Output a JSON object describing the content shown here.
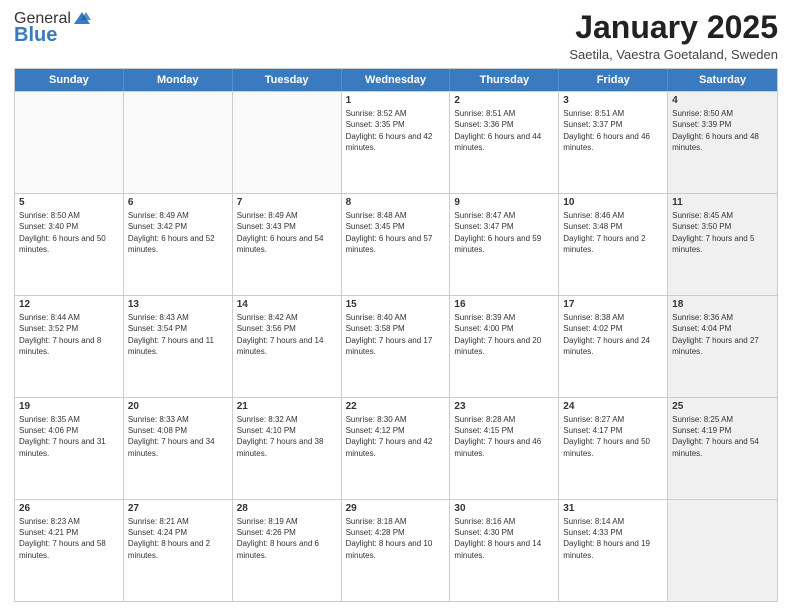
{
  "header": {
    "logo_general": "General",
    "logo_blue": "Blue",
    "month_title": "January 2025",
    "location": "Saetila, Vaestra Goetaland, Sweden"
  },
  "weekdays": [
    "Sunday",
    "Monday",
    "Tuesday",
    "Wednesday",
    "Thursday",
    "Friday",
    "Saturday"
  ],
  "rows": [
    [
      {
        "day": "",
        "text": "",
        "empty": true
      },
      {
        "day": "",
        "text": "",
        "empty": true
      },
      {
        "day": "",
        "text": "",
        "empty": true
      },
      {
        "day": "1",
        "text": "Sunrise: 8:52 AM\nSunset: 3:35 PM\nDaylight: 6 hours and 42 minutes."
      },
      {
        "day": "2",
        "text": "Sunrise: 8:51 AM\nSunset: 3:36 PM\nDaylight: 6 hours and 44 minutes."
      },
      {
        "day": "3",
        "text": "Sunrise: 8:51 AM\nSunset: 3:37 PM\nDaylight: 6 hours and 46 minutes."
      },
      {
        "day": "4",
        "text": "Sunrise: 8:50 AM\nSunset: 3:39 PM\nDaylight: 6 hours and 48 minutes.",
        "shaded": true
      }
    ],
    [
      {
        "day": "5",
        "text": "Sunrise: 8:50 AM\nSunset: 3:40 PM\nDaylight: 6 hours and 50 minutes."
      },
      {
        "day": "6",
        "text": "Sunrise: 8:49 AM\nSunset: 3:42 PM\nDaylight: 6 hours and 52 minutes."
      },
      {
        "day": "7",
        "text": "Sunrise: 8:49 AM\nSunset: 3:43 PM\nDaylight: 6 hours and 54 minutes."
      },
      {
        "day": "8",
        "text": "Sunrise: 8:48 AM\nSunset: 3:45 PM\nDaylight: 6 hours and 57 minutes."
      },
      {
        "day": "9",
        "text": "Sunrise: 8:47 AM\nSunset: 3:47 PM\nDaylight: 6 hours and 59 minutes."
      },
      {
        "day": "10",
        "text": "Sunrise: 8:46 AM\nSunset: 3:48 PM\nDaylight: 7 hours and 2 minutes."
      },
      {
        "day": "11",
        "text": "Sunrise: 8:45 AM\nSunset: 3:50 PM\nDaylight: 7 hours and 5 minutes.",
        "shaded": true
      }
    ],
    [
      {
        "day": "12",
        "text": "Sunrise: 8:44 AM\nSunset: 3:52 PM\nDaylight: 7 hours and 8 minutes."
      },
      {
        "day": "13",
        "text": "Sunrise: 8:43 AM\nSunset: 3:54 PM\nDaylight: 7 hours and 11 minutes."
      },
      {
        "day": "14",
        "text": "Sunrise: 8:42 AM\nSunset: 3:56 PM\nDaylight: 7 hours and 14 minutes."
      },
      {
        "day": "15",
        "text": "Sunrise: 8:40 AM\nSunset: 3:58 PM\nDaylight: 7 hours and 17 minutes."
      },
      {
        "day": "16",
        "text": "Sunrise: 8:39 AM\nSunset: 4:00 PM\nDaylight: 7 hours and 20 minutes."
      },
      {
        "day": "17",
        "text": "Sunrise: 8:38 AM\nSunset: 4:02 PM\nDaylight: 7 hours and 24 minutes."
      },
      {
        "day": "18",
        "text": "Sunrise: 8:36 AM\nSunset: 4:04 PM\nDaylight: 7 hours and 27 minutes.",
        "shaded": true
      }
    ],
    [
      {
        "day": "19",
        "text": "Sunrise: 8:35 AM\nSunset: 4:06 PM\nDaylight: 7 hours and 31 minutes."
      },
      {
        "day": "20",
        "text": "Sunrise: 8:33 AM\nSunset: 4:08 PM\nDaylight: 7 hours and 34 minutes."
      },
      {
        "day": "21",
        "text": "Sunrise: 8:32 AM\nSunset: 4:10 PM\nDaylight: 7 hours and 38 minutes."
      },
      {
        "day": "22",
        "text": "Sunrise: 8:30 AM\nSunset: 4:12 PM\nDaylight: 7 hours and 42 minutes."
      },
      {
        "day": "23",
        "text": "Sunrise: 8:28 AM\nSunset: 4:15 PM\nDaylight: 7 hours and 46 minutes."
      },
      {
        "day": "24",
        "text": "Sunrise: 8:27 AM\nSunset: 4:17 PM\nDaylight: 7 hours and 50 minutes."
      },
      {
        "day": "25",
        "text": "Sunrise: 8:25 AM\nSunset: 4:19 PM\nDaylight: 7 hours and 54 minutes.",
        "shaded": true
      }
    ],
    [
      {
        "day": "26",
        "text": "Sunrise: 8:23 AM\nSunset: 4:21 PM\nDaylight: 7 hours and 58 minutes."
      },
      {
        "day": "27",
        "text": "Sunrise: 8:21 AM\nSunset: 4:24 PM\nDaylight: 8 hours and 2 minutes."
      },
      {
        "day": "28",
        "text": "Sunrise: 8:19 AM\nSunset: 4:26 PM\nDaylight: 8 hours and 6 minutes."
      },
      {
        "day": "29",
        "text": "Sunrise: 8:18 AM\nSunset: 4:28 PM\nDaylight: 8 hours and 10 minutes."
      },
      {
        "day": "30",
        "text": "Sunrise: 8:16 AM\nSunset: 4:30 PM\nDaylight: 8 hours and 14 minutes."
      },
      {
        "day": "31",
        "text": "Sunrise: 8:14 AM\nSunset: 4:33 PM\nDaylight: 8 hours and 19 minutes."
      },
      {
        "day": "",
        "text": "",
        "empty": true,
        "shaded": true
      }
    ]
  ]
}
